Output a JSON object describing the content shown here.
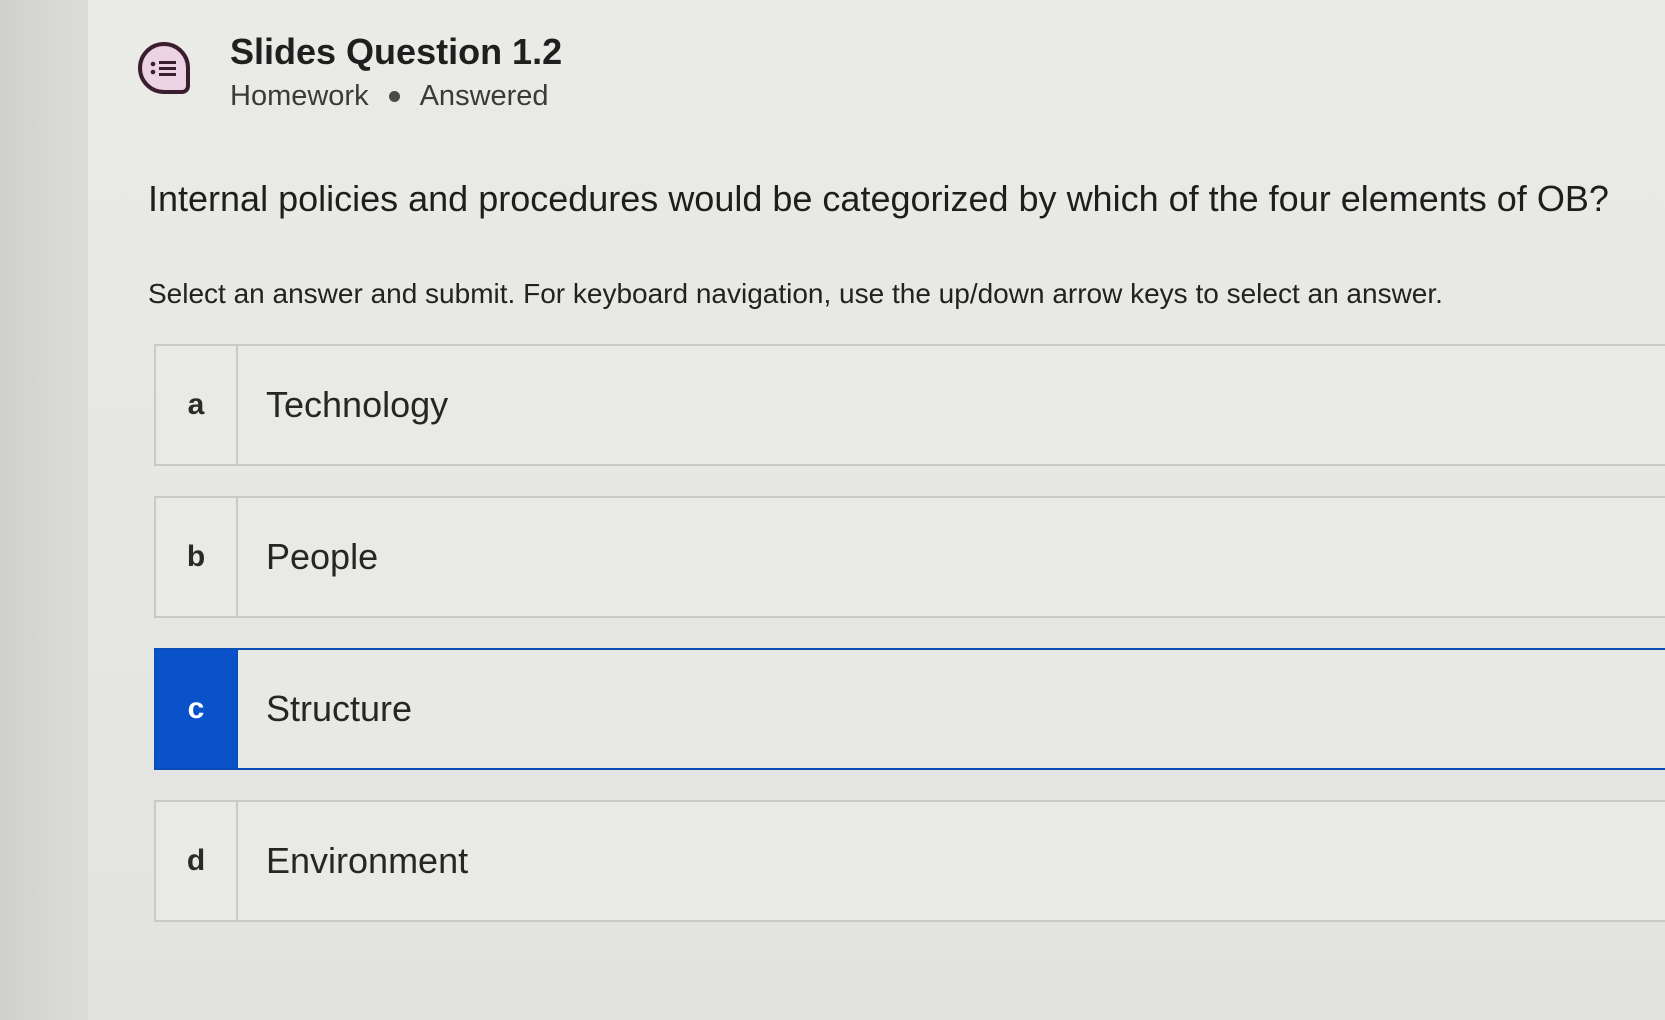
{
  "header": {
    "title": "Slides Question 1.2",
    "category": "Homework",
    "status": "Answered",
    "icon": "list-bubble-icon"
  },
  "question": {
    "text": "Internal policies and procedures would be categorized by which of the four elements of OB?",
    "instructions": "Select an answer and submit. For keyboard navigation, use the up/down arrow keys to select an answer."
  },
  "options": [
    {
      "letter": "a",
      "label": "Technology",
      "selected": false
    },
    {
      "letter": "b",
      "label": "People",
      "selected": false
    },
    {
      "letter": "c",
      "label": "Structure",
      "selected": true
    },
    {
      "letter": "d",
      "label": "Environment",
      "selected": false
    }
  ],
  "colors": {
    "selected_accent": "#0a52c9",
    "icon_fill": "#ecd3e4",
    "icon_stroke": "#3a1d2e"
  }
}
